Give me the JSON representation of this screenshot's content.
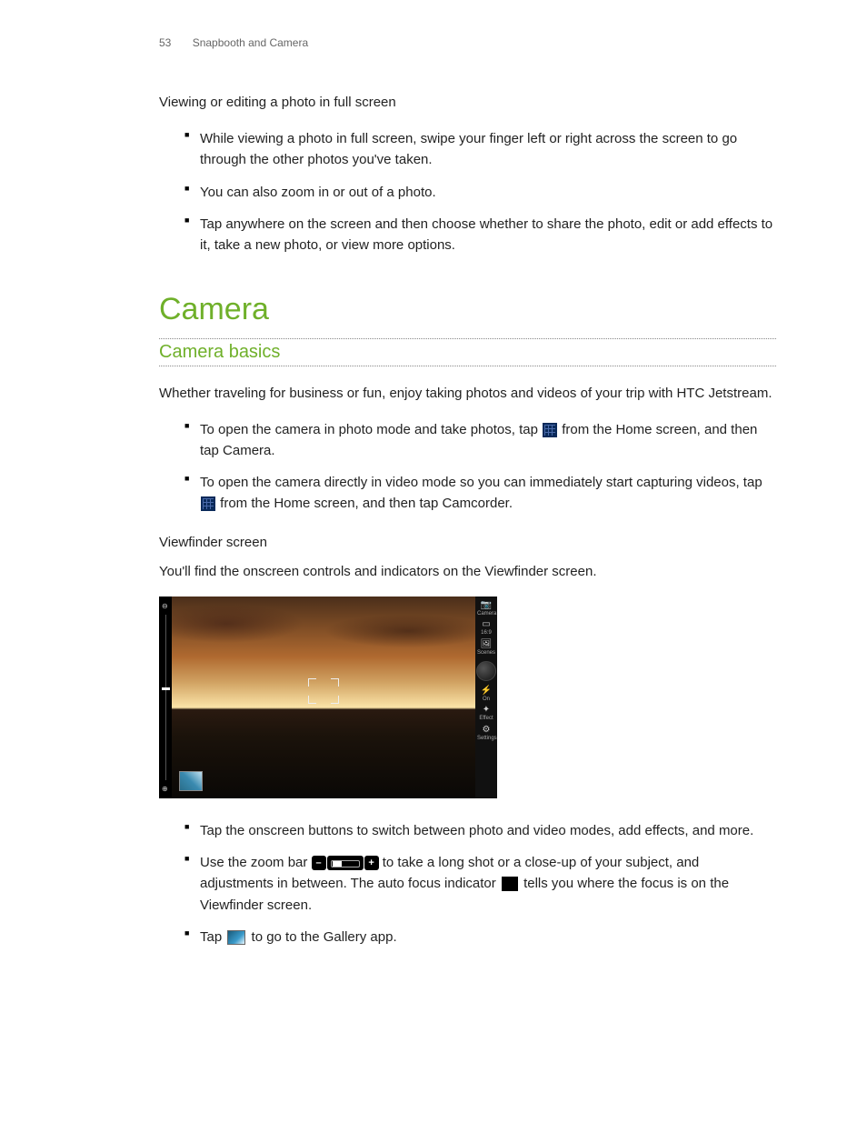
{
  "header": {
    "pagenum": "53",
    "section": "Snapbooth and Camera"
  },
  "section1": {
    "title": "Viewing or editing a photo in full screen",
    "bullets": [
      "While viewing a photo in full screen, swipe your finger left or right across the screen to go through the other photos you've taken.",
      "You can also zoom in or out of a photo.",
      "Tap anywhere on the screen and then choose whether to share the photo, edit or add effects to it, take a new photo, or view more options."
    ]
  },
  "h1": "Camera",
  "h2": "Camera basics",
  "intro": "Whether traveling for business or fun, enjoy taking photos and videos of your trip with HTC Jetstream.",
  "open_bullets": {
    "b1a": "To open the camera in photo mode and take photos, tap ",
    "b1b": " from the Home screen, and then tap ",
    "b1c": "Camera",
    "b1d": ".",
    "b2a": "To open the camera directly in video mode so you can immediately start capturing videos, tap ",
    "b2b": " from the Home screen, and then tap ",
    "b2c": "Camcorder",
    "b2d": "."
  },
  "vf_heading": "Viewfinder screen",
  "vf_para": "You'll find the onscreen controls and indicators on the Viewfinder screen.",
  "vf_labels": {
    "camera": "Camera",
    "ratio": "16:9",
    "scenes": "Scenes",
    "flash": "On",
    "effect": "Effect",
    "settings": "Settings"
  },
  "bottom_bullets": {
    "b1": "Tap the onscreen buttons to switch between photo and video modes, add effects, and more.",
    "b2a": "Use the zoom bar ",
    "b2b": " to take a long shot or a close-up of your subject, and adjustments in between. The auto focus indicator ",
    "b2c": " tells you where the focus is on the Viewfinder screen.",
    "b3a": "Tap ",
    "b3b": " to go to the Gallery app."
  }
}
